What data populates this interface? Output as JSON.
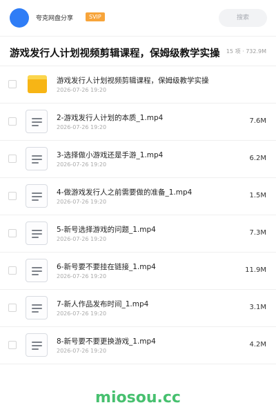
{
  "header": {
    "app_name": "夸克网盘分享",
    "badge": "SVIP",
    "search_placeholder": "搜索",
    "colors": {
      "avatar": "#2f7df6",
      "badge": "#f7a43a"
    }
  },
  "folder": {
    "title": "游戏发行人计划视频剪辑课程，保姆级教学实操",
    "meta": "15 项 · 732.9M"
  },
  "files": [
    {
      "icon": "folder-icon",
      "name": "游戏发行人计划视频剪辑课程，保姆级教学实操",
      "date": "2026-07-26 19:20",
      "size": ""
    },
    {
      "icon": "video-file-icon",
      "name": "2-游戏发行人计划的本质_1.mp4",
      "date": "2026-07-26 19:20",
      "size": "7.6M"
    },
    {
      "icon": "video-file-icon",
      "name": "3-选择做小游戏还是手游_1.mp4",
      "date": "2026-07-26 19:20",
      "size": "6.2M"
    },
    {
      "icon": "video-file-icon",
      "name": "4-做游戏发行人之前需要做的准备_1.mp4",
      "date": "2026-07-26 19:20",
      "size": "1.5M"
    },
    {
      "icon": "video-file-icon",
      "name": "5-新号选择游戏的问题_1.mp4",
      "date": "2026-07-26 19:20",
      "size": "7.3M"
    },
    {
      "icon": "video-file-icon",
      "name": "6-新号要不要挂在链接_1.mp4",
      "date": "2026-07-26 19:20",
      "size": "11.9M"
    },
    {
      "icon": "video-file-icon",
      "name": "7-新人作品发布时间_1.mp4",
      "date": "2026-07-26 19:20",
      "size": "3.1M"
    },
    {
      "icon": "video-file-icon",
      "name": "8-新号要不要更换游戏_1.mp4",
      "date": "2026-07-26 19:20",
      "size": "4.2M"
    }
  ],
  "watermark": "miosou.cc"
}
